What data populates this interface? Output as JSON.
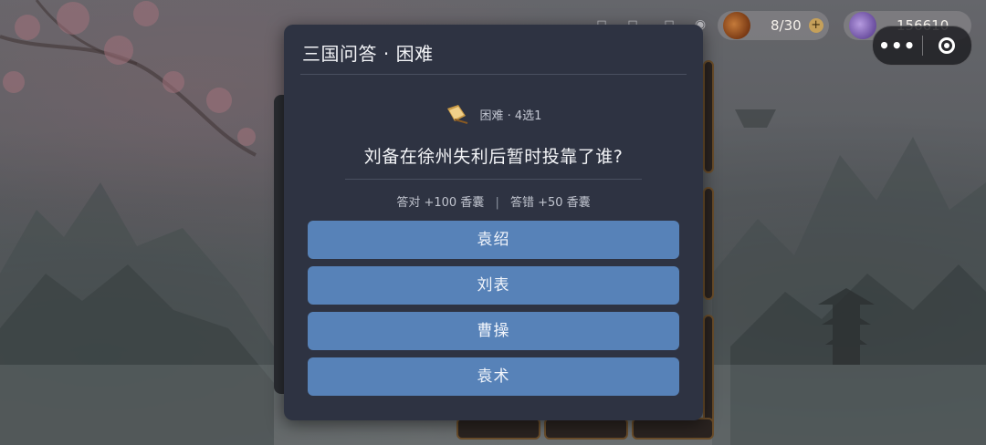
{
  "hud": {
    "bag_count": "8/30",
    "coins": "156610",
    "plus_symbol": "+"
  },
  "capsule": {
    "more_label": "•••"
  },
  "dialog": {
    "title": "三国问答 · 困难",
    "meta": "困难 · 4选1",
    "question": "刘备在徐州失利后暂时投靠了谁?",
    "reward_correct": "答对 +100 香囊",
    "reward_separator": "|",
    "reward_wrong": "答错 +50 香囊",
    "options": [
      "袁绍",
      "刘表",
      "曹操",
      "袁术"
    ]
  },
  "colors": {
    "dialog_bg": "#2e3342",
    "option_bg": "#5782b8"
  },
  "icons": {
    "meta": "scroll-quill-icon",
    "bag": "money-bag-icon",
    "coin": "coin-pouch-icon"
  }
}
